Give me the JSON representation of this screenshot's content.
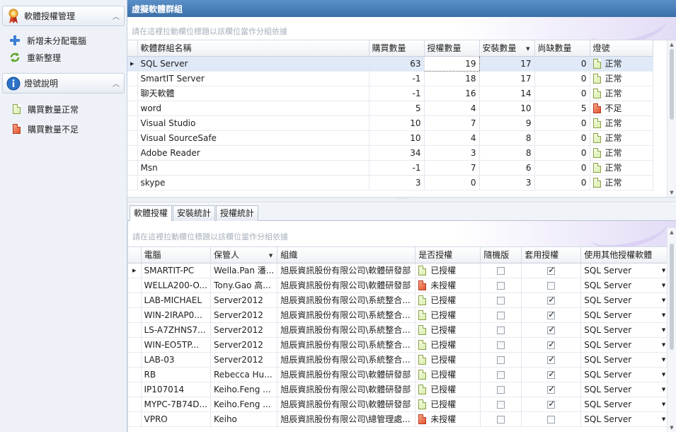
{
  "sidebar": {
    "section1": {
      "title": "軟體授權管理"
    },
    "items": [
      {
        "label": "新增未分配電腦"
      },
      {
        "label": "重新整理"
      }
    ],
    "section2": {
      "title": "燈號說明"
    },
    "legend": [
      {
        "label": "購買數量正常",
        "color": "green"
      },
      {
        "label": "購買數量不足",
        "color": "red"
      }
    ]
  },
  "main": {
    "title": "虛擬軟體群組",
    "group_hint": "請在這裡拉動欄位標題以該欄位當作分組依據",
    "top_grid": {
      "columns": [
        "軟體群組名稱",
        "購買數量",
        "授權數量",
        "安裝數量",
        "尚缺數量",
        "燈號"
      ],
      "rows": [
        [
          "SQL Server",
          "63",
          "19",
          "17",
          "0",
          "正常"
        ],
        [
          "SmartIT Server",
          "-1",
          "18",
          "17",
          "0",
          "正常"
        ],
        [
          "聊天軟體",
          "-1",
          "16",
          "14",
          "0",
          "正常"
        ],
        [
          "word",
          "5",
          "4",
          "10",
          "5",
          "不足"
        ],
        [
          "Visual Studio",
          "10",
          "7",
          "9",
          "0",
          "正常"
        ],
        [
          "Visual SourceSafe",
          "10",
          "4",
          "8",
          "0",
          "正常"
        ],
        [
          "Adobe Reader",
          "34",
          "3",
          "8",
          "0",
          "正常"
        ],
        [
          "Msn",
          "-1",
          "7",
          "6",
          "0",
          "正常"
        ],
        [
          "skype",
          "3",
          "0",
          "3",
          "0",
          "正常"
        ]
      ]
    },
    "tabs": [
      "軟體授權",
      "安裝統計",
      "授權統計"
    ],
    "bottom_grid": {
      "group_hint": "請在這裡拉動欄位標題以該欄位當作分組依據",
      "columns": [
        "電腦",
        "保管人",
        "組織",
        "是否授權",
        "隨機版",
        "套用授權",
        "使用其他授權軟體"
      ],
      "rows": [
        [
          "SMARTIT-PC",
          "Wella.Pan 潘...",
          "旭辰資訊股份有限公司\\軟體研發部",
          "已授權",
          false,
          true,
          "SQL Server"
        ],
        [
          "WELLA200-O...",
          "Tony.Gao 高...",
          "旭辰資訊股份有限公司\\軟體研發部",
          "未授權",
          false,
          false,
          "SQL Server"
        ],
        [
          "LAB-MICHAEL",
          "Server2012",
          "旭辰資訊股份有限公司\\系統整合...",
          "已授權",
          false,
          true,
          "SQL Server"
        ],
        [
          "WIN-2IRAP0...",
          "Server2012",
          "旭辰資訊股份有限公司\\系統整合...",
          "已授權",
          false,
          true,
          "SQL Server"
        ],
        [
          "LS-A7ZHNS7...",
          "Server2012",
          "旭辰資訊股份有限公司\\系統整合...",
          "已授權",
          false,
          true,
          "SQL Server"
        ],
        [
          "WIN-EO5TP...",
          "Server2012",
          "旭辰資訊股份有限公司\\系統整合...",
          "已授權",
          false,
          true,
          "SQL Server"
        ],
        [
          "LAB-03",
          "Server2012",
          "旭辰資訊股份有限公司\\系統整合...",
          "已授權",
          false,
          true,
          "SQL Server"
        ],
        [
          "RB",
          "Rebecca Hu...",
          "旭辰資訊股份有限公司\\軟體研發部",
          "已授權",
          false,
          true,
          "SQL Server"
        ],
        [
          "IP107014",
          "Keiho.Feng ...",
          "旭辰資訊股份有限公司\\軟體研發部",
          "已授權",
          false,
          true,
          "SQL Server"
        ],
        [
          "MYPC-7B74D...",
          "Keiho.Feng ...",
          "旭辰資訊股份有限公司\\軟體研發部",
          "已授權",
          false,
          true,
          "SQL Server"
        ],
        [
          "VPRO",
          "Keiho",
          "旭辰資訊股份有限公司\\總管理處...",
          "未授權",
          false,
          false,
          "SQL Server"
        ]
      ]
    }
  },
  "colors": {
    "titlebar": "#3b6fa9",
    "ok": "#b8dc7a",
    "bad": "#e2542f",
    "selection": "#dfe9f8"
  }
}
